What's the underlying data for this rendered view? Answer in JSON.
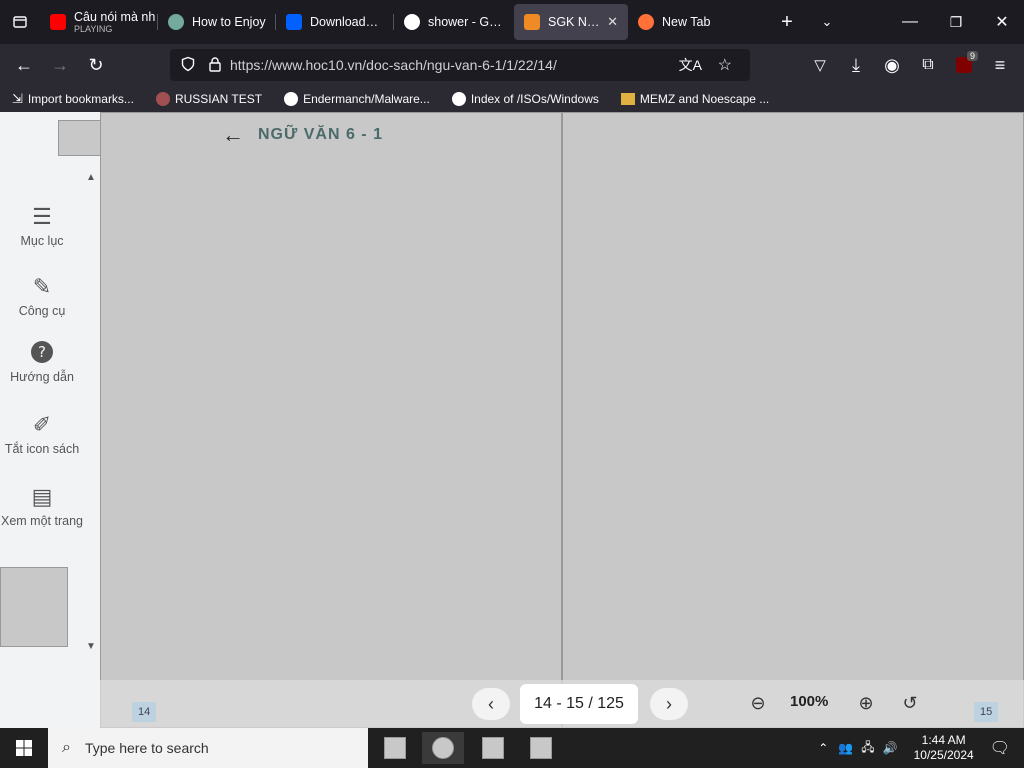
{
  "tabs": [
    {
      "label": "Câu nói mà nh",
      "sublabel": "PLAYING",
      "icon": "youtube-icon"
    },
    {
      "label": "How to Enjoy",
      "icon": "chatgpt-icon"
    },
    {
      "label": "Downloads - B",
      "icon": "dropbox-icon"
    },
    {
      "label": "shower - Goog",
      "icon": "google-icon"
    },
    {
      "label": "SGK Ngữ vă",
      "icon": "hoc10-icon",
      "active": true
    },
    {
      "label": "New Tab",
      "icon": "firefox-icon"
    }
  ],
  "nav": {
    "url": "https://www.hoc10.vn/doc-sach/ngu-van-6-1/1/22/14/",
    "extension_badge": "9"
  },
  "bookmarks": [
    {
      "label": "Import bookmarks...",
      "icon": "import-icon"
    },
    {
      "label": "RUSSIAN TEST",
      "icon": "link-icon"
    },
    {
      "label": "Endermanch/Malware...",
      "icon": "google-icon"
    },
    {
      "label": "Index of /ISOs/Windows",
      "icon": "google-icon"
    },
    {
      "label": "MEMZ and Noescape ...",
      "icon": "bookmark-icon"
    }
  ],
  "sidebar": {
    "items": [
      {
        "label": "Mục lục",
        "icon": "menu-icon"
      },
      {
        "label": "Công cụ",
        "icon": "pencil-icon"
      },
      {
        "label": "Hướng dẫn",
        "icon": "help-icon"
      },
      {
        "label": "Tắt icon sách",
        "icon": "edit-icon"
      },
      {
        "label": "Xem một trang",
        "icon": "page-icon"
      }
    ]
  },
  "book": {
    "series": "NGỮ VĂN 6 - 1"
  },
  "viewer": {
    "pages": "14 - 15 / 125",
    "zoom": "100%",
    "left_page": "14",
    "right_page": "15"
  },
  "taskbar": {
    "search_placeholder": "Type here to search",
    "time": "1:44 AM",
    "date": "10/25/2024"
  },
  "colors": {
    "browser_dark": "#1c1b22",
    "toolbar": "#2b2a33",
    "accent_blue": "#3daee9"
  }
}
